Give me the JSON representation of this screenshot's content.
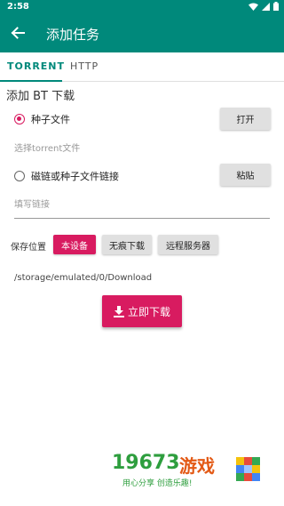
{
  "status": {
    "time": "2:58"
  },
  "appbar": {
    "title": "添加任务"
  },
  "tabs": [
    {
      "label": "TORRENT"
    },
    {
      "label": "HTTP"
    }
  ],
  "section": {
    "title": "添加 BT 下载"
  },
  "torrent_option": {
    "label": "种子文件",
    "hint": "选择torrent文件",
    "button": "打开"
  },
  "magnet_option": {
    "label": "磁链或种子文件链接",
    "hint": "填写链接",
    "button": "粘贴"
  },
  "save": {
    "label": "保存位置",
    "options": [
      {
        "label": "本设备"
      },
      {
        "label": "无痕下载"
      },
      {
        "label": "远程服务器"
      }
    ],
    "path": "/storage/emulated/0/Download"
  },
  "download_button": {
    "label": "立即下载"
  },
  "watermark": {
    "number": "19673",
    "name": "游戏",
    "slogan": "用心分享  创造乐趣!"
  },
  "colors": {
    "primary": "#00897b",
    "accent": "#d81b60",
    "button_gray": "#e0e0e0"
  }
}
